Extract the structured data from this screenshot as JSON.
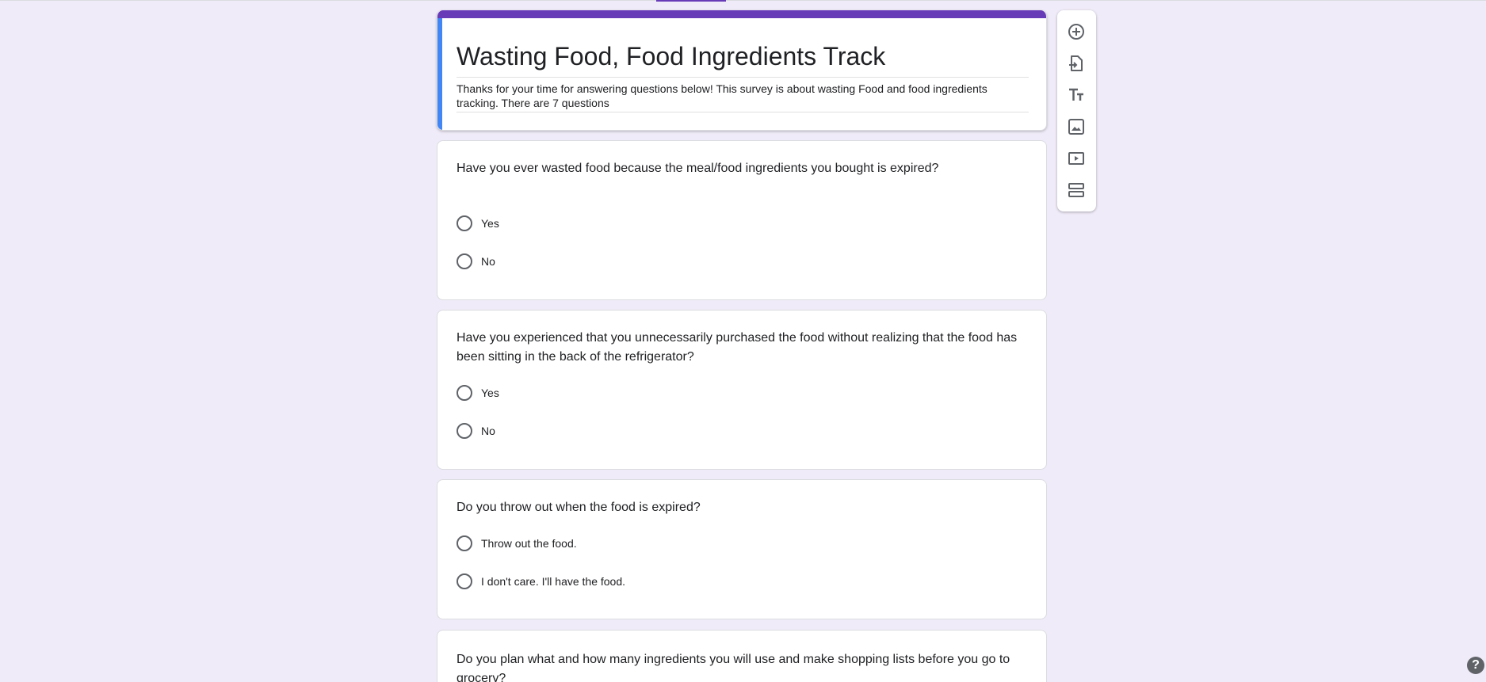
{
  "form": {
    "title": "Wasting Food, Food Ingredients Track",
    "description": "Thanks for your time for answering questions below! This survey is about wasting Food and food ingredients tracking. There are 7 questions"
  },
  "questions": [
    {
      "text": "Have you ever wasted food because the meal/food ingredients you bought is expired?",
      "options": [
        "Yes",
        "No"
      ]
    },
    {
      "text": "Have you experienced that you unnecessarily purchased the food without realizing that the food has been sitting in the back of the refrigerator?",
      "options": [
        "Yes",
        "No"
      ]
    },
    {
      "text": "Do you throw out when the food is expired?",
      "options": [
        "Throw out the food.",
        "I don't care. I'll have the food."
      ]
    },
    {
      "text": "Do you plan what and how many ingredients you will use and make shopping lists before you go to grocery?",
      "options": []
    }
  ],
  "toolbar": {
    "icons": [
      "add-question-icon",
      "import-questions-icon",
      "add-title-icon",
      "add-image-icon",
      "add-video-icon",
      "add-section-icon"
    ]
  },
  "help": {
    "label": "?"
  },
  "colors": {
    "background": "#f0ebf8",
    "accent": "#673ab7",
    "header_left_bar": "#4285f4"
  }
}
